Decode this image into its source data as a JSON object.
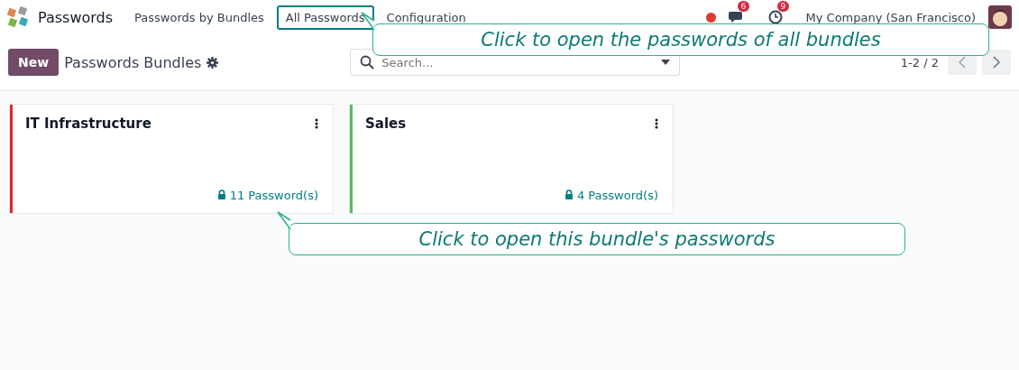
{
  "navbar": {
    "app_name": "Passwords",
    "menu": [
      {
        "label": "Passwords by Bundles",
        "selected": false
      },
      {
        "label": "All Passwords",
        "selected": true
      },
      {
        "label": "Configuration",
        "selected": false
      }
    ],
    "messages_count": "6",
    "activities_count": "9",
    "company": "My Company (San Francisco)"
  },
  "control_panel": {
    "new_button": "New",
    "title": "Passwords Bundles",
    "search": {
      "placeholder": "Search..."
    },
    "pager": "1-2 / 2"
  },
  "bundles": [
    {
      "name": "IT Infrastructure",
      "count": "11 Password(s)",
      "color": "#e5242b"
    },
    {
      "name": "Sales",
      "count": "4 Password(s)",
      "color": "#5cb85c"
    }
  ],
  "callouts": [
    {
      "text": "Click to open the passwords of all bundles",
      "kind": "top"
    },
    {
      "text": "Click to open this bundle's passwords",
      "kind": "card"
    }
  ]
}
